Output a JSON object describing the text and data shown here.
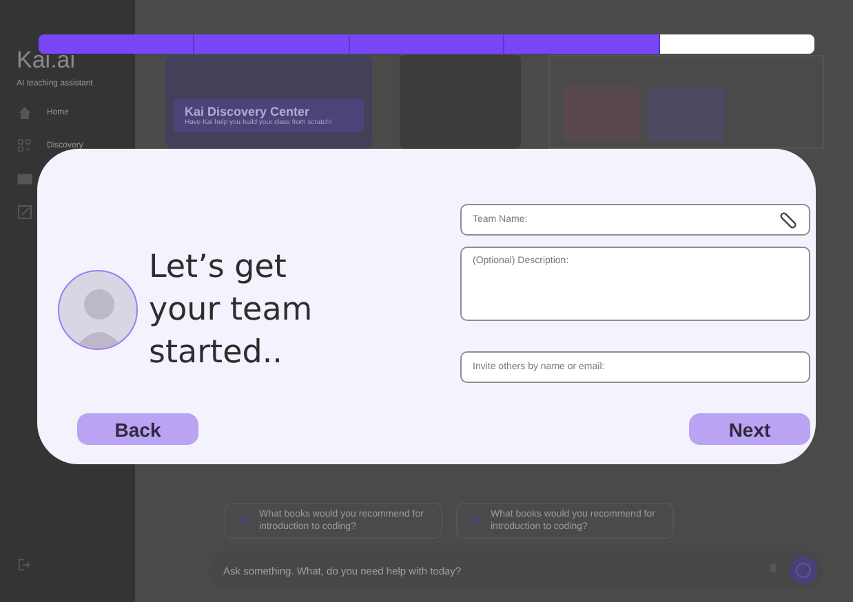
{
  "sidebar": {
    "logo": "Kai.ai",
    "tagline": "AI teaching assistant",
    "items": [
      {
        "kind": "home",
        "label": "Home"
      },
      {
        "kind": "grid",
        "label": "Discovery"
      },
      {
        "kind": "book"
      },
      {
        "kind": "edit"
      }
    ]
  },
  "hero": {
    "title": "Kai Discovery Center",
    "subtitle": "Have Kai help you build your class from scratch!"
  },
  "suggestions": [
    {
      "text": "What books would you recommend for introduction to coding?"
    },
    {
      "text": "What books would you recommend for introduction to coding?"
    }
  ],
  "ask": {
    "placeholder": "Ask something. What, do you need help with today?"
  },
  "progress": {
    "steps": [
      {
        "done": true
      },
      {
        "done": true
      },
      {
        "done": true
      },
      {
        "done": true
      },
      {
        "done": false
      }
    ]
  },
  "modal": {
    "heading": "Let’s get your team started..",
    "fields": [
      {
        "kind": "line",
        "placeholder": "Team Name:",
        "attach": true
      },
      {
        "kind": "area",
        "placeholder": "(Optional) Description:",
        "attach": false
      },
      {
        "kind": "line",
        "placeholder": "Invite others by name or email:",
        "attach": false
      }
    ],
    "back": "Back",
    "next": "Next"
  }
}
